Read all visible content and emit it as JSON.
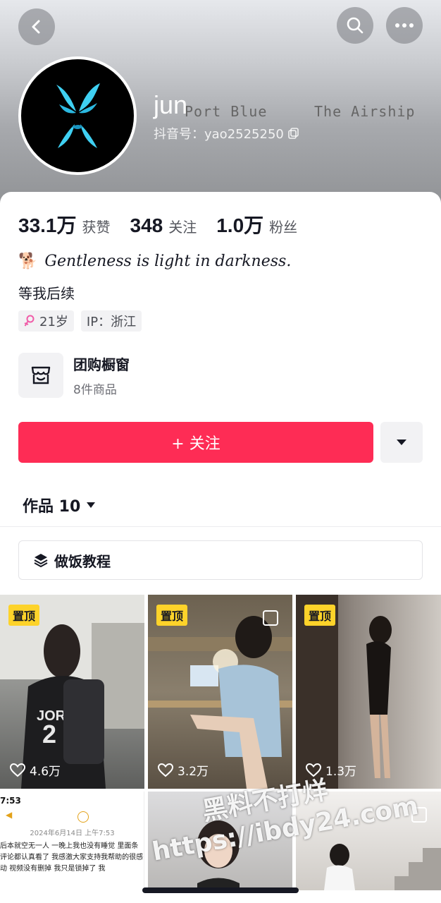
{
  "header": {
    "back_icon": "chevron-left-icon",
    "search_icon": "search-icon",
    "more_icon": "ellipsis-icon",
    "banner_text_1": "Port Blue",
    "banner_text_2": "The Airship"
  },
  "profile": {
    "nickname": "jun",
    "douyin_id": "抖音号：yao2525250",
    "copy_icon": "copy-icon"
  },
  "stats": [
    {
      "num": "33.1万",
      "label": "获赞"
    },
    {
      "num": "348",
      "label": "关注"
    },
    {
      "num": "1.0万",
      "label": "粉丝"
    }
  ],
  "bio": {
    "emoji": "🐕",
    "line1": "Gentleness is light in darkness.",
    "line2": "等我后续"
  },
  "tags": {
    "age": "21岁",
    "ip": "IP：浙江"
  },
  "shop": {
    "title": "团购橱窗",
    "subtitle": "8件商品"
  },
  "actions": {
    "follow": "+ 关注",
    "more_icon": "caret-down-icon"
  },
  "works": {
    "tab_label": "作品 10",
    "collection": "做饭教程"
  },
  "videos": [
    {
      "pinned": "置顶",
      "likes": "4.6万"
    },
    {
      "pinned": "置顶",
      "likes": "3.2万"
    },
    {
      "pinned": "置顶",
      "likes": "1.3万"
    },
    {
      "status_time": "7:53",
      "note_date": "2024年6月14日 上午7:53",
      "note_text": "后本就空无一人 一晚上我也没有睡觉 里面条评论都认真看了 我感激大家支持我帮助的很感动 视频没有删掉 我只是锁掉了 我"
    },
    {},
    {}
  ],
  "watermark": {
    "line1": "黑料不打烊",
    "line2": "https://ibdy24.com"
  },
  "colors": {
    "accent": "#fe2c55",
    "pin": "#fdd32a"
  }
}
